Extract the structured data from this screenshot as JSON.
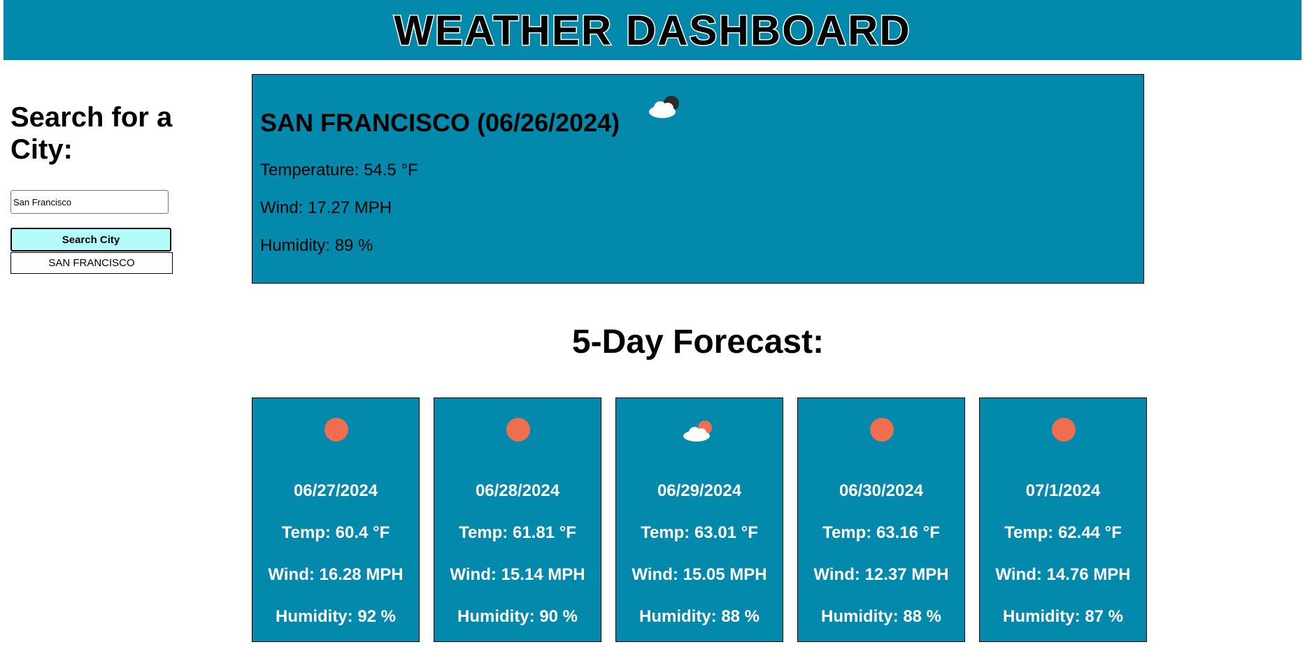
{
  "header": {
    "title": "WEATHER DASHBOARD"
  },
  "sidebar": {
    "heading": "Search for a City:",
    "search_value": "San Francisco",
    "search_button": "Search City",
    "history": [
      "SAN FRANCISCO"
    ]
  },
  "current": {
    "city_date": "SAN FRANCISCO (06/26/2024)",
    "icon": "partly-cloudy-night-icon",
    "temperature": "Temperature: 54.5 °F",
    "wind": "Wind: 17.27 MPH",
    "humidity": "Humidity: 89 %"
  },
  "forecast": {
    "title": "5-Day Forecast:",
    "days": [
      {
        "icon": "sun-icon",
        "date": "06/27/2024",
        "temp": "Temp: 60.4 °F",
        "wind": "Wind: 16.28 MPH",
        "humidity": "Humidity: 92 %"
      },
      {
        "icon": "sun-icon",
        "date": "06/28/2024",
        "temp": "Temp: 61.81 °F",
        "wind": "Wind: 15.14 MPH",
        "humidity": "Humidity: 90 %"
      },
      {
        "icon": "partly-cloudy-day-icon",
        "date": "06/29/2024",
        "temp": "Temp: 63.01 °F",
        "wind": "Wind: 15.05 MPH",
        "humidity": "Humidity: 88 %"
      },
      {
        "icon": "sun-icon",
        "date": "06/30/2024",
        "temp": "Temp: 63.16 °F",
        "wind": "Wind: 12.37 MPH",
        "humidity": "Humidity: 88 %"
      },
      {
        "icon": "sun-icon",
        "date": "07/1/2024",
        "temp": "Temp: 62.44 °F",
        "wind": "Wind: 14.76 MPH",
        "humidity": "Humidity: 87 %"
      }
    ]
  },
  "colors": {
    "panel": "#0289AB",
    "button": "#B3FBFB",
    "sun": "#EE6E4F"
  }
}
